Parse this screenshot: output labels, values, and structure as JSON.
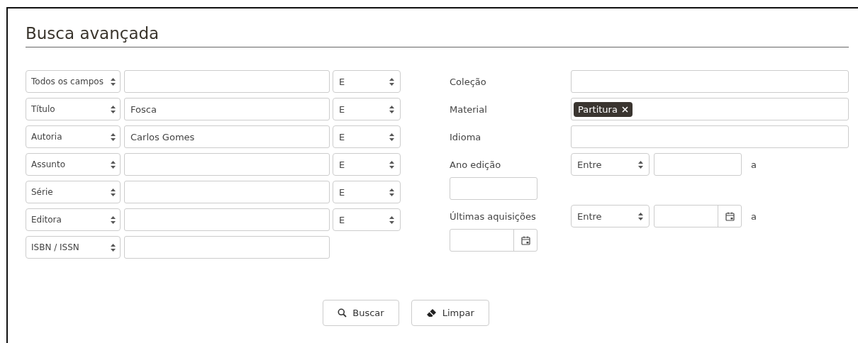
{
  "title": "Busca avançada",
  "criteria": [
    {
      "field": "Todos os campos",
      "operator": "E"
    },
    {
      "field": "Título",
      "value": "Fosca",
      "operator": "E"
    },
    {
      "field": "Autoria",
      "value": "Carlos Gomes",
      "operator": "E"
    },
    {
      "field": "Assunto",
      "operator": "E"
    },
    {
      "field": "Série",
      "operator": "E"
    },
    {
      "field": "Editora",
      "operator": "E"
    },
    {
      "field": "ISBN / ISSN"
    }
  ],
  "filters": [
    {
      "kind": "text",
      "label": "Coleção"
    },
    {
      "kind": "tags",
      "label": "Material",
      "tags": [
        "Partitura"
      ]
    },
    {
      "kind": "text",
      "label": "Idioma"
    },
    {
      "kind": "range",
      "label": "Ano edição",
      "mode": "Entre",
      "separator": "a"
    },
    {
      "kind": "date_range",
      "label": "Últimas aquisições",
      "mode": "Entre",
      "separator": "a"
    }
  ],
  "buttons": [
    {
      "kind": "search",
      "label": "Buscar"
    },
    {
      "kind": "clear",
      "label": "Limpar"
    }
  ]
}
